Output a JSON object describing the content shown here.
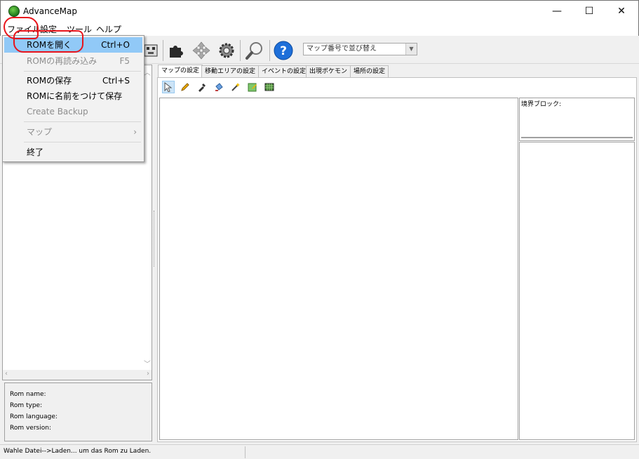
{
  "window": {
    "title": "AdvanceMap",
    "minimize": "—",
    "maximize": "☐",
    "close": "✕"
  },
  "menubar": {
    "file": "ファイル",
    "settings": "設定",
    "tools": "ツール",
    "help": "ヘルプ"
  },
  "toolbar": {
    "sort_placeholder": "マップ番号で並び替え"
  },
  "tabs": [
    "マップの設定",
    "移動エリアの設定",
    "イベントの設定",
    "出現ポケモン",
    "場所の設定"
  ],
  "border_block_label": "境界ブロック:",
  "rom_info": {
    "name": "Rom name:",
    "type": "Rom type:",
    "language": "Rom language:",
    "version": "Rom version:"
  },
  "status": "Wahle Datei-->Laden... um das Rom zu Laden.",
  "file_menu": {
    "open": {
      "label": "ROMを開く",
      "shortcut": "Ctrl+O"
    },
    "reload": {
      "label": "ROMの再読み込み",
      "shortcut": "F5"
    },
    "save": {
      "label": "ROMの保存",
      "shortcut": "Ctrl+S"
    },
    "save_as": {
      "label": "ROMに名前をつけて保存"
    },
    "backup": {
      "label": "Create Backup"
    },
    "map": {
      "label": "マップ",
      "arrow": "›"
    },
    "exit": {
      "label": "終了"
    }
  },
  "colors": {
    "highlight": "#91c9f7",
    "annotation": "#e8141b",
    "accent_help": "#1e6fd9"
  }
}
